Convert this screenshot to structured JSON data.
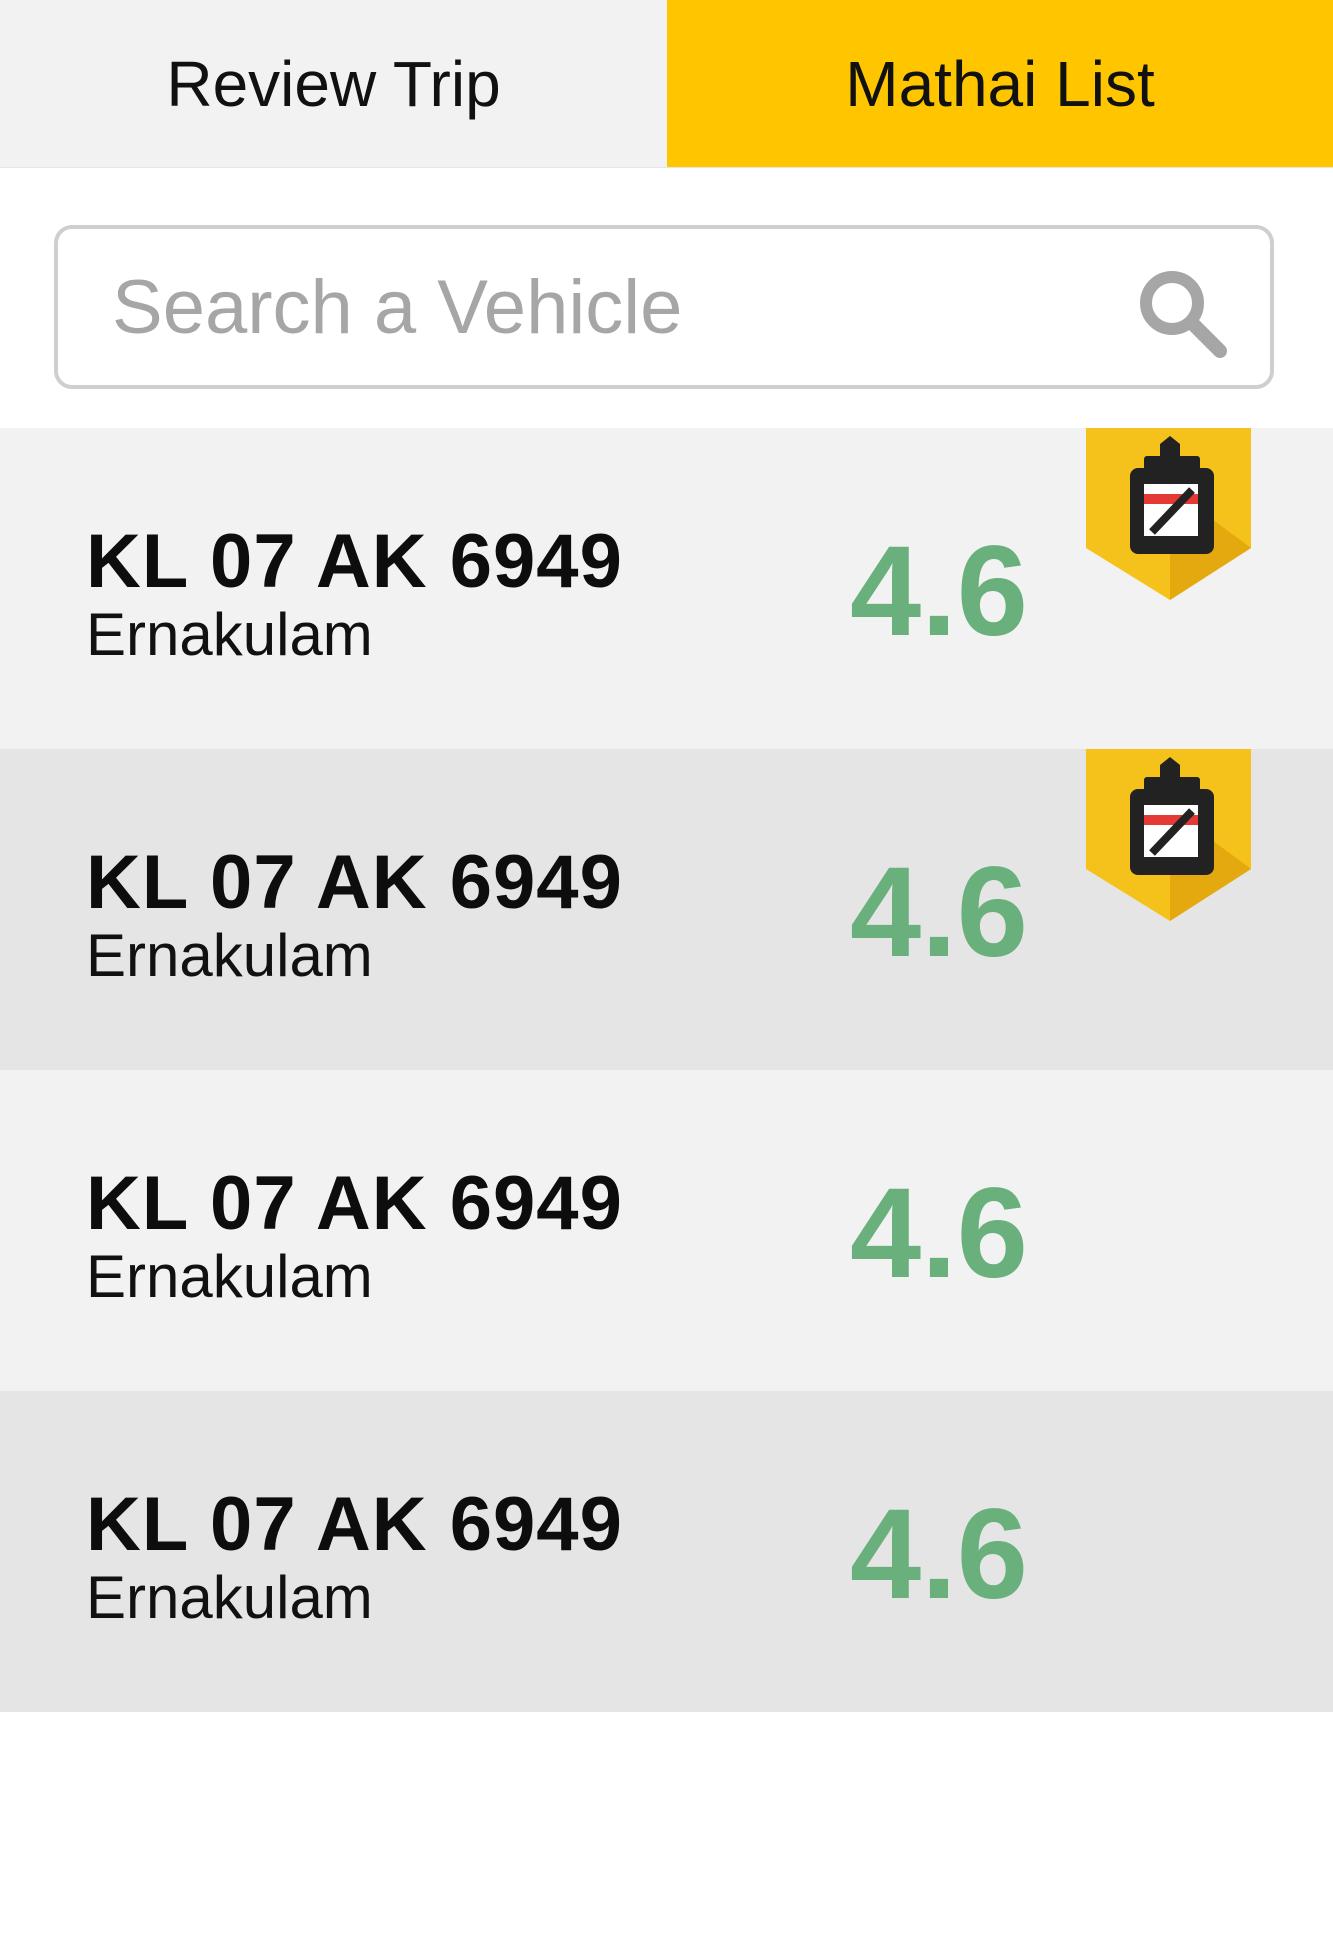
{
  "tabs": [
    {
      "label": "Review Trip",
      "active": false
    },
    {
      "label": "Mathai List",
      "active": true
    }
  ],
  "search": {
    "placeholder": "Search a Vehicle",
    "value": ""
  },
  "vehicles": [
    {
      "plate": "KL 07 AK 6949",
      "city": "Ernakulam",
      "rating": "4.6",
      "badge": "meter-badge-icon"
    },
    {
      "plate": "KL 07 AK 6949",
      "city": "Ernakulam",
      "rating": "4.6",
      "badge": "meter-badge-icon"
    },
    {
      "plate": "KL 07 AK 6949",
      "city": "Ernakulam",
      "rating": "4.6"
    },
    {
      "plate": "KL 07 AK 6949",
      "city": "Ernakulam",
      "rating": "4.6"
    }
  ],
  "colors": {
    "active_tab": "#ffc600",
    "inactive_tab": "#f2f2f2",
    "rating": "#69b07d",
    "row_light": "#f2f2f2",
    "row_dark": "#e5e5e5",
    "badge": "#f4c21a"
  }
}
